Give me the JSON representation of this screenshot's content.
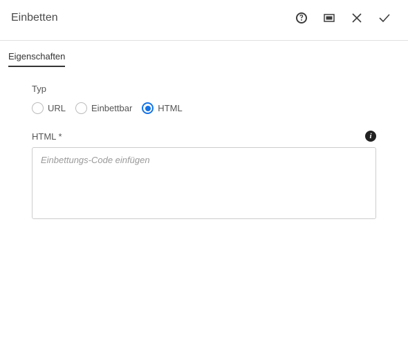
{
  "header": {
    "title": "Einbetten"
  },
  "tabs": {
    "properties": "Eigenschaften"
  },
  "form": {
    "type_label": "Typ",
    "radio_url": "URL",
    "radio_embeddable": "Einbettbar",
    "radio_html": "HTML",
    "html_label": "HTML *",
    "html_placeholder": "Einbettungs-Code einfügen"
  }
}
